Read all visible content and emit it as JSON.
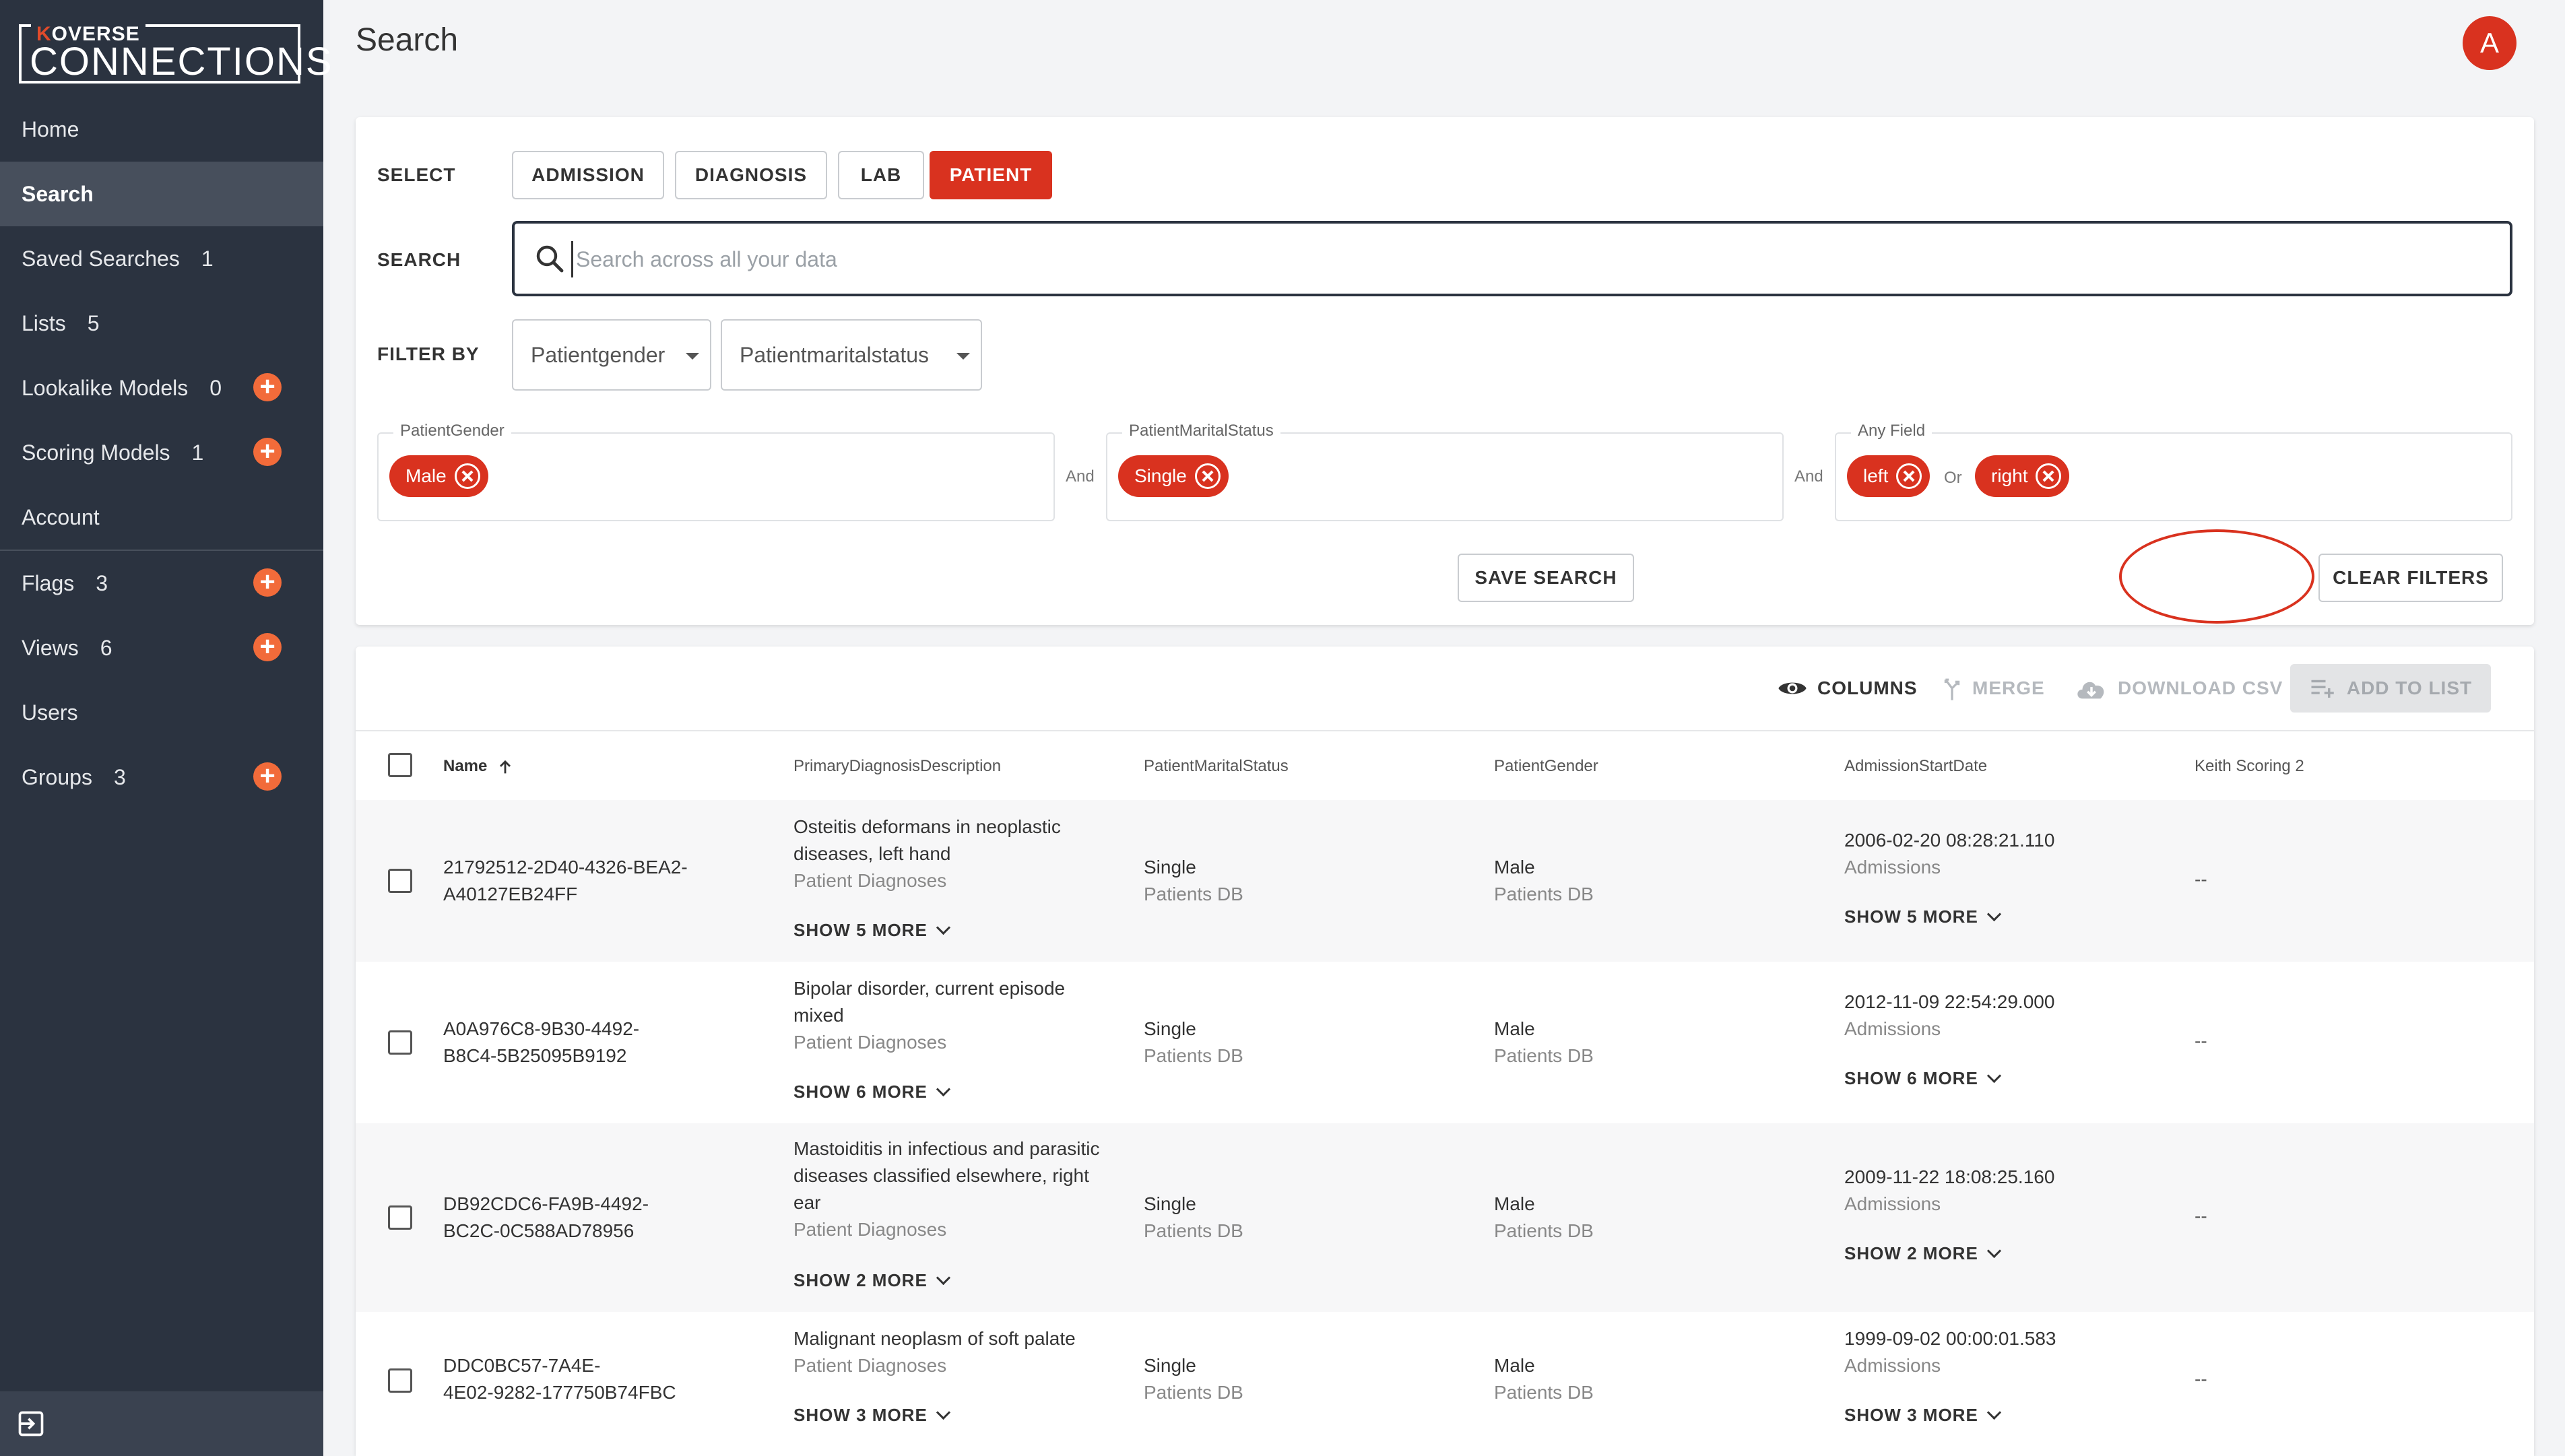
{
  "sidebar": {
    "logo_top_k": "K",
    "logo_top_rest": "OVERSE",
    "logo_main": "CONNECTIONS",
    "items": [
      {
        "label": "Home",
        "count": ""
      },
      {
        "label": "Search",
        "count": ""
      },
      {
        "label": "Saved Searches",
        "count": "1"
      },
      {
        "label": "Lists",
        "count": "5"
      },
      {
        "label": "Lookalike Models",
        "count": "0"
      },
      {
        "label": "Scoring Models",
        "count": "1"
      },
      {
        "label": "Account",
        "count": ""
      },
      {
        "label": "Flags",
        "count": "3"
      },
      {
        "label": "Views",
        "count": "6"
      },
      {
        "label": "Users",
        "count": ""
      },
      {
        "label": "Groups",
        "count": "3"
      }
    ],
    "plus_symbol": "+"
  },
  "header": {
    "title": "Search",
    "avatar_initial": "A"
  },
  "search_panel": {
    "select_label": "SELECT",
    "types": [
      "ADMISSION",
      "DIAGNOSIS",
      "LAB",
      "PATIENT"
    ],
    "active_type": "PATIENT",
    "search_label": "SEARCH",
    "search_placeholder": "Search across all your data",
    "filter_label": "FILTER BY",
    "filter_selects": [
      "Patientgender",
      "Patientmaritalstatus"
    ],
    "groups": [
      {
        "legend": "PatientGender",
        "chips": [
          "Male"
        ]
      },
      {
        "legend": "PatientMaritalStatus",
        "chips": [
          "Single"
        ]
      },
      {
        "legend": "Any Field",
        "chips": [
          "left",
          "right"
        ],
        "chip_conj": "Or"
      }
    ],
    "group_conj": "And",
    "save_search": "SAVE SEARCH",
    "clear_filters": "CLEAR FILTERS"
  },
  "results": {
    "toolbar": {
      "columns": "COLUMNS",
      "merge": "MERGE",
      "download": "DOWNLOAD CSV",
      "add_to_list": "ADD TO LIST"
    },
    "columns": [
      "Name",
      "PrimaryDiagnosisDescription",
      "PatientMaritalStatus",
      "PatientGender",
      "AdmissionStartDate",
      "Keith Scoring 2"
    ],
    "rows": [
      {
        "name1": "21792512-2D40-4326-BEA2-",
        "name2": "A40127EB24FF",
        "diag": [
          "Osteitis deformans in neoplastic",
          "diseases, left hand"
        ],
        "diag_src": "Patient Diagnoses",
        "diag_more": "SHOW 5 MORE",
        "marital": "Single",
        "marital_src": "Patients DB",
        "gender": "Male",
        "gender_src": "Patients DB",
        "date": "2006-02-20 08:28:21.110",
        "date_src": "Admissions",
        "date_more": "SHOW 5 MORE",
        "score": "--"
      },
      {
        "name1": "A0A976C8-9B30-4492-",
        "name2": "B8C4-5B25095B9192",
        "diag": [
          "Bipolar disorder, current episode",
          "mixed"
        ],
        "diag_src": "Patient Diagnoses",
        "diag_more": "SHOW 6 MORE",
        "marital": "Single",
        "marital_src": "Patients DB",
        "gender": "Male",
        "gender_src": "Patients DB",
        "date": "2012-11-09 22:54:29.000",
        "date_src": "Admissions",
        "date_more": "SHOW 6 MORE",
        "score": "--"
      },
      {
        "name1": "DB92CDC6-FA9B-4492-",
        "name2": "BC2C-0C588AD78956",
        "diag": [
          "Mastoiditis in infectious and parasitic",
          "diseases classified elsewhere, right",
          "ear"
        ],
        "diag_src": "Patient Diagnoses",
        "diag_more": "SHOW 2 MORE",
        "marital": "Single",
        "marital_src": "Patients DB",
        "gender": "Male",
        "gender_src": "Patients DB",
        "date": "2009-11-22 18:08:25.160",
        "date_src": "Admissions",
        "date_more": "SHOW 2 MORE",
        "score": "--"
      },
      {
        "name1": "DDC0BC57-7A4E-",
        "name2": "4E02-9282-177750B74FBC",
        "diag": [
          "Malignant neoplasm of soft palate"
        ],
        "diag_src": "Patient Diagnoses",
        "diag_more": "SHOW 3 MORE",
        "marital": "Single",
        "marital_src": "Patients DB",
        "gender": "Male",
        "gender_src": "Patients DB",
        "date": "1999-09-02 00:00:01.583",
        "date_src": "Admissions",
        "date_more": "SHOW 3 MORE",
        "score": "--"
      }
    ]
  }
}
